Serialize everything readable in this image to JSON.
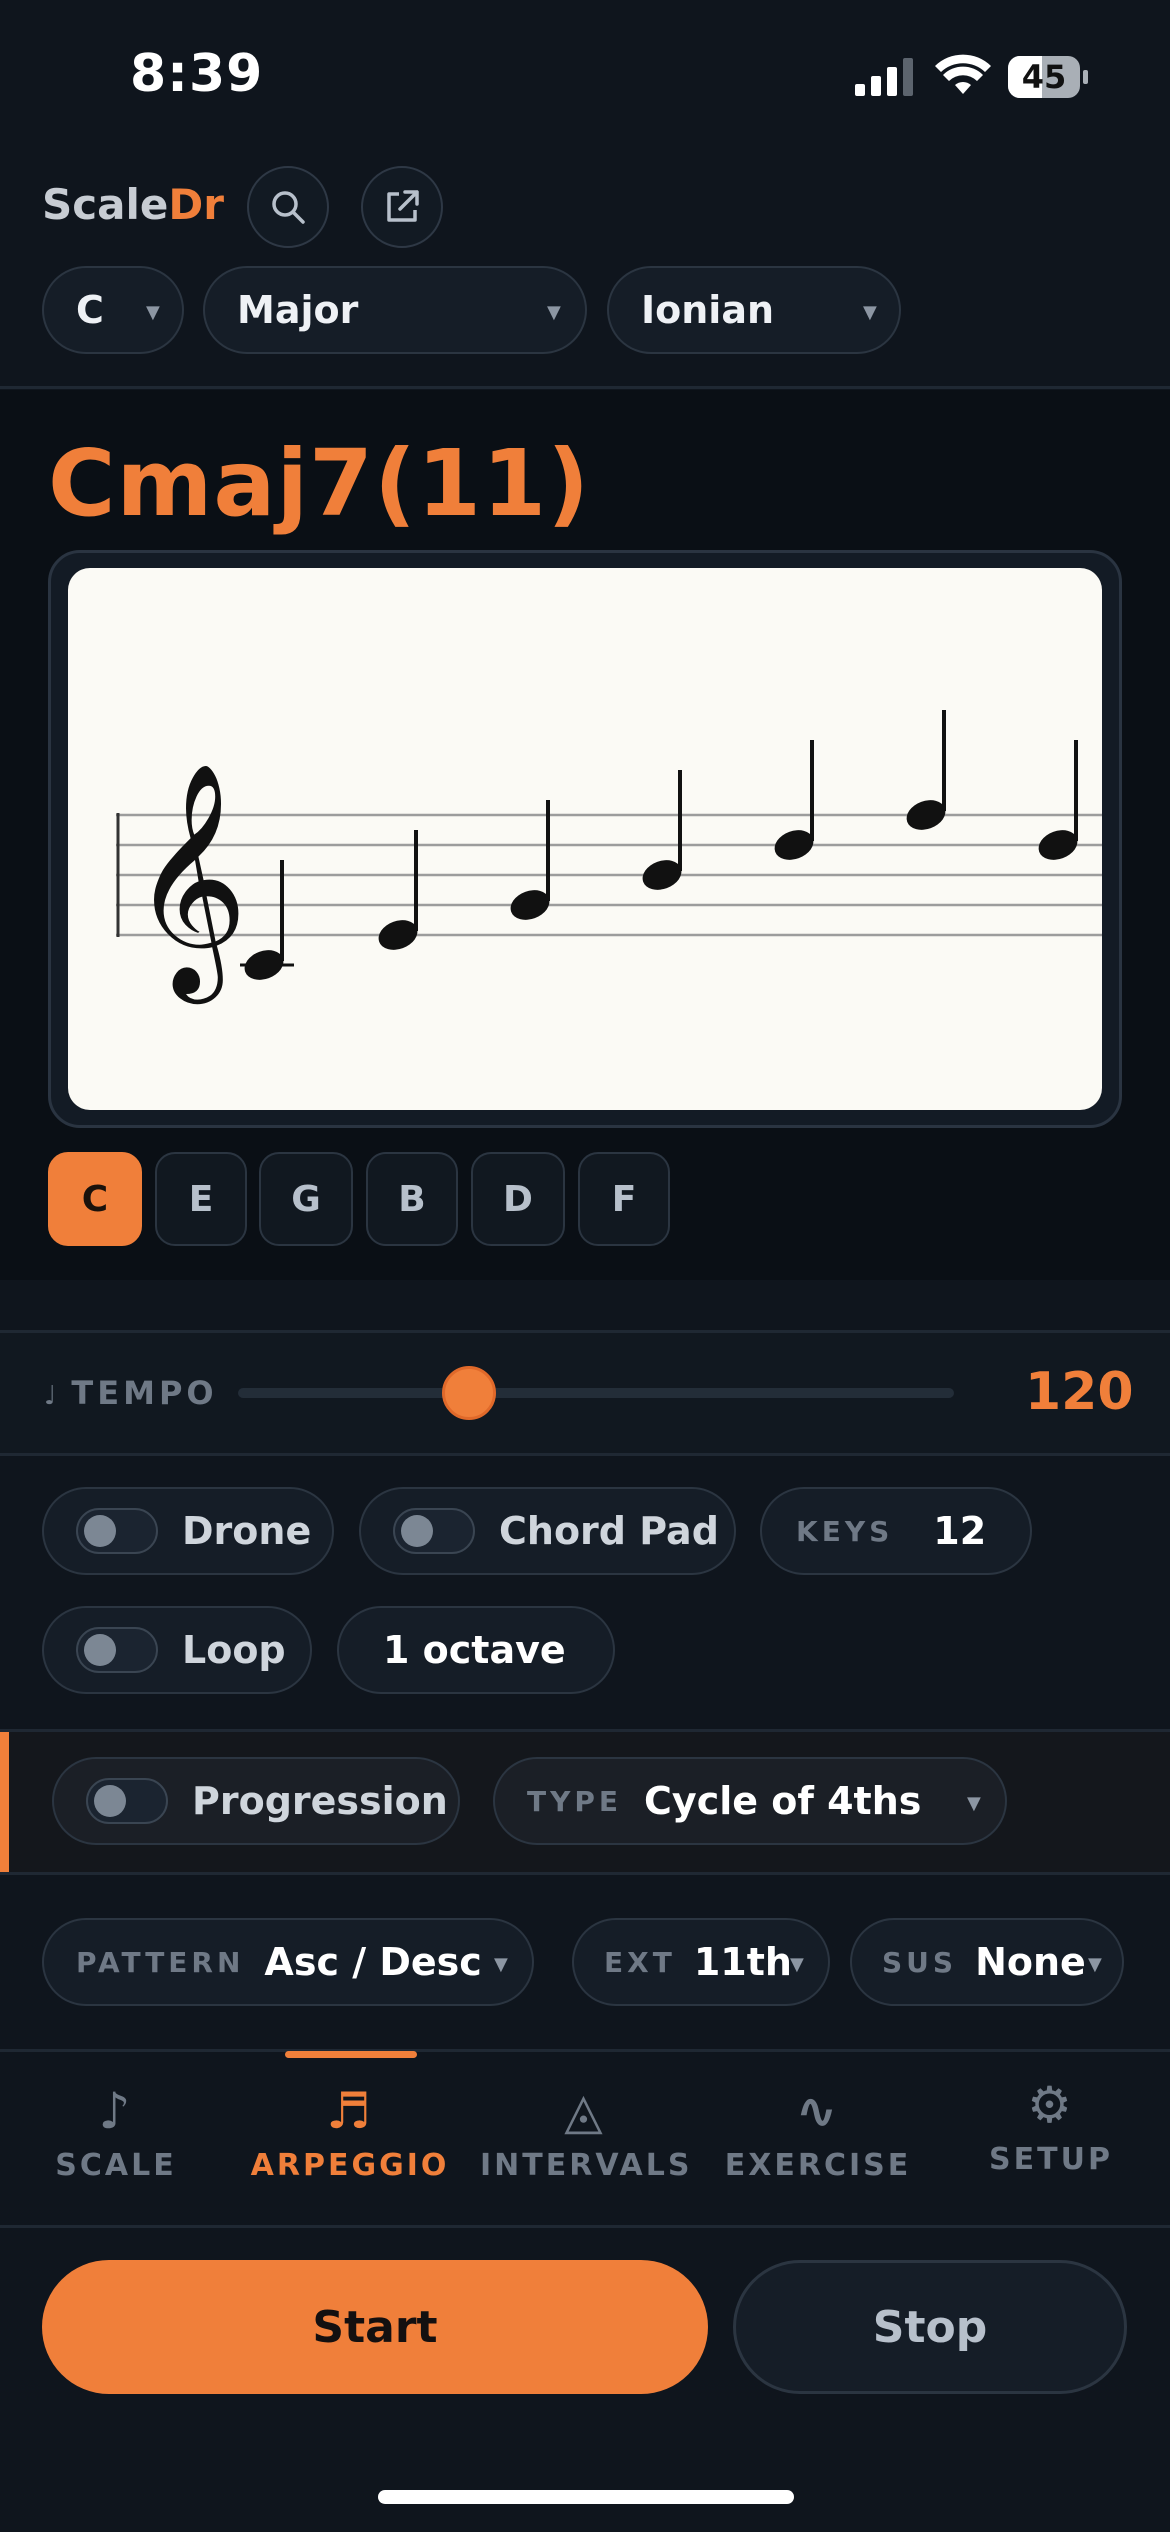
{
  "status_bar": {
    "time": "8:39",
    "battery": "45"
  },
  "header": {
    "brand_part1": "Scale",
    "brand_part2": "Dr",
    "search_icon": "search-icon",
    "share_icon": "external-link-icon"
  },
  "selectors": {
    "key": "C",
    "scale": "Major",
    "mode": "Ionian"
  },
  "chord": {
    "name": "Cmaj7(11)",
    "notes": [
      "C",
      "E",
      "G",
      "B",
      "D",
      "F"
    ],
    "active_note": "C",
    "staff_clef": "treble-clef"
  },
  "tempo": {
    "label": "TEMPO",
    "value": "120",
    "level": 0.33
  },
  "options": {
    "drone_label": "Drone",
    "chord_pad_label": "Chord Pad",
    "keys_label": "KEYS",
    "keys_value": "12",
    "loop_label": "Loop",
    "octave_value": "1 octave"
  },
  "progression": {
    "label": "Progression",
    "type_label": "TYPE",
    "type_value": "Cycle of 4ths"
  },
  "pattern": {
    "pattern_label": "PATTERN",
    "pattern_value": "Asc / Desc",
    "ext_label": "EXT",
    "ext_value": "11th",
    "sus_label": "SUS",
    "sus_value": "None"
  },
  "tabs": [
    {
      "label": "SCALE",
      "icon": "♪"
    },
    {
      "label": "ARPEGGIO",
      "icon": "♬"
    },
    {
      "label": "INTERVALS",
      "icon": "◬"
    },
    {
      "label": "EXERCISE",
      "icon": "∿"
    },
    {
      "label": "SETUP",
      "icon": "⚙"
    }
  ],
  "active_tab": "ARPEGGIO",
  "actions": {
    "start": "Start",
    "stop": "Stop"
  },
  "colors": {
    "accent": "#f07f3a",
    "background": "#0f151d"
  }
}
